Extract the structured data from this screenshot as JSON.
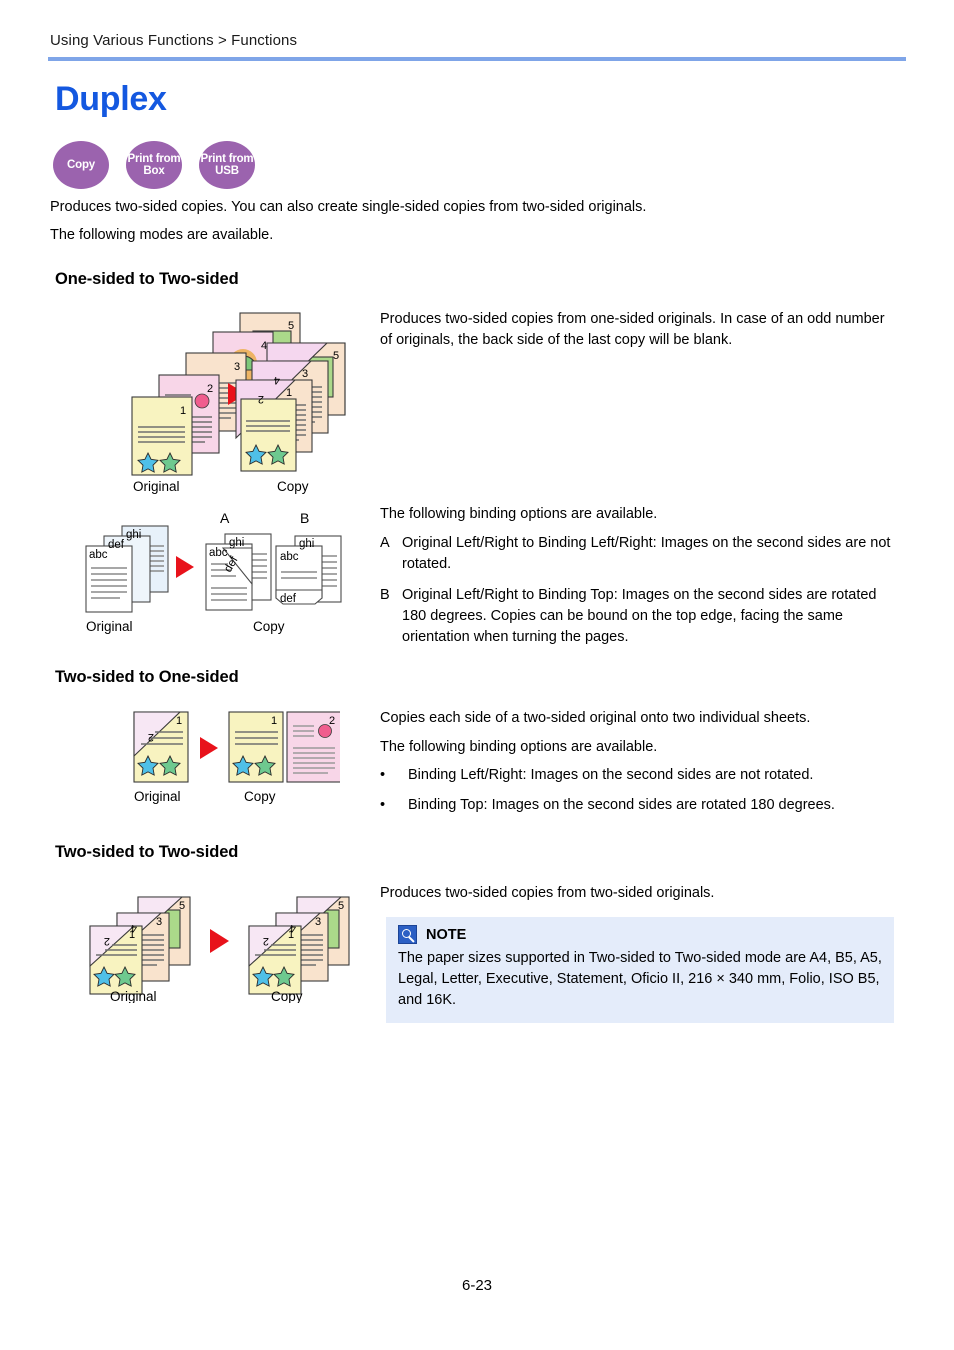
{
  "header": {
    "breadcrumb": "Using Various Functions > Functions"
  },
  "title": "Duplex",
  "badges": [
    {
      "name": "copy",
      "label": "Copy"
    },
    {
      "name": "print-from-box",
      "label": "Print from Box"
    },
    {
      "name": "print-from-usb",
      "label": "Print from USB"
    }
  ],
  "intro": {
    "line1": "Produces two-sided copies. You can also create single-sided copies from two-sided originals.",
    "line2": "The following modes are available."
  },
  "sections": {
    "one_to_two": {
      "heading": "One-sided to Two-sided",
      "description": "Produces two-sided copies from one-sided originals. In case of an odd number of originals, the back side of the last copy will be blank.",
      "binding_intro": "The following binding options are available.",
      "options": [
        {
          "key": "A",
          "text": "Original Left/Right to Binding Left/Right: Images on the second sides are not rotated."
        },
        {
          "key": "B",
          "text": "Original Left/Right to Binding Top: Images on the second sides are rotated 180 degrees. Copies can be bound on the top edge, facing the same orientation when turning the pages."
        }
      ],
      "fig_original_label": "Original",
      "fig_copy_label": "Copy",
      "fig2_original_label": "Original",
      "fig2_copy_label": "Copy",
      "fig2_marker_a": "A",
      "fig2_marker_b": "B",
      "page_numbers": [
        "1",
        "2",
        "3",
        "4",
        "5"
      ],
      "text_labels": [
        "abc",
        "def",
        "ghi"
      ]
    },
    "two_to_one": {
      "heading": "Two-sided to One-sided",
      "description": "Copies each side of a two-sided original onto two individual sheets.",
      "binding_intro": "The following binding options are available.",
      "bullets": [
        "Binding Left/Right: Images on the second sides are not rotated.",
        "Binding Top: Images on the second sides are rotated 180 degrees."
      ],
      "bullet_mark": "•",
      "fig_original_label": "Original",
      "fig_copy_label": "Copy"
    },
    "two_to_two": {
      "heading": "Two-sided to Two-sided",
      "description": "Produces two-sided copies from two-sided originals.",
      "fig_original_label": "Original",
      "fig_copy_label": "Copy"
    }
  },
  "note": {
    "title": "NOTE",
    "body": "The paper sizes supported in Two-sided to Two-sided mode are A4, B5, A5, Legal, Letter, Executive, Statement, Oficio II, 216 × 340 mm, Folio, ISO B5, and 16K."
  },
  "footer": {
    "page_number": "6-23"
  },
  "colors": {
    "title_blue": "#1458e0",
    "rule_blue": "#7fa5e8",
    "badge_purple": "#9b63ae",
    "note_bg": "#e4ecfa",
    "note_icon_blue": "#2b5fc4",
    "arrow_red": "#e8121b",
    "paper_yellow": "#f8f3c0",
    "paper_pink": "#f8d6e8",
    "paper_beige": "#f9e3cd",
    "paper_green": "#abd98a",
    "paper_blue": "#dceaf7"
  }
}
